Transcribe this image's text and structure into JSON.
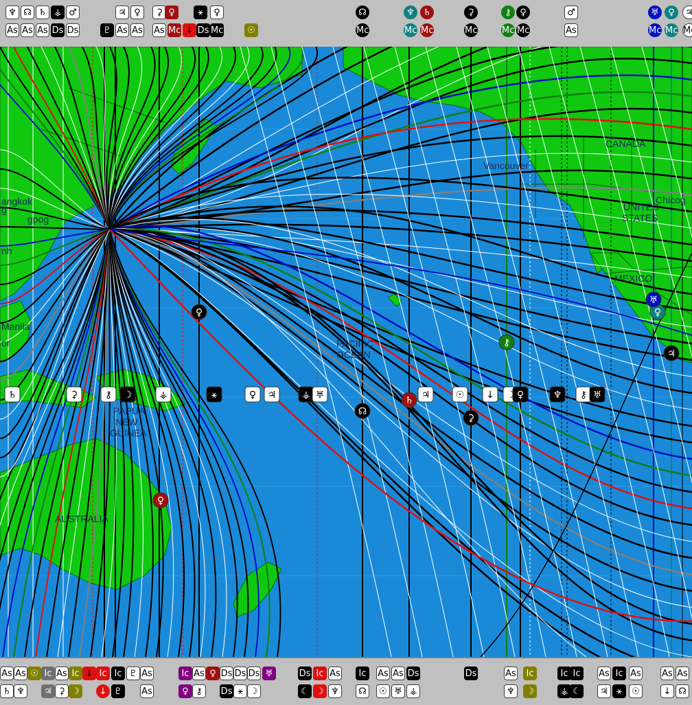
{
  "map": {
    "labels": {
      "canada": "CANADA",
      "vancouver": "Vancouver",
      "chicago": "Chicog",
      "united": "UNITED",
      "states": "STATES",
      "mexico": "MEXICO",
      "pacific": "PACIFIC",
      "ocean": "OCEAN",
      "papua": "PAPUA",
      "new": "NEW",
      "guinea": "GUINEA",
      "australia": "AUSTRALIA",
      "manila": "Manila",
      "frag_bangkok": "angkok",
      "frag_g": "g",
      "frag_dog": "gpog",
      "frag_nh": "nh",
      "frag_or": "or"
    }
  },
  "top_bar": {
    "row1": [
      {
        "g": "♆",
        "bg": "#ffffff",
        "fg": "#000000"
      },
      {
        "g": "☊",
        "bg": "#ffffff",
        "fg": "#000000"
      },
      {
        "g": "♄",
        "bg": "#ffffff",
        "fg": "#000000"
      },
      {
        "g": "⚶",
        "bg": "#000000",
        "fg": "#ffffff"
      },
      {
        "g": "♂",
        "bg": "#ffffff",
        "fg": "#000000"
      },
      {
        "g": "♃",
        "bg": "#ffffff",
        "fg": "#000000"
      },
      {
        "g": "♀",
        "bg": "#ffffff",
        "fg": "#000000"
      },
      {
        "g": "⚳",
        "bg": "#ffffff",
        "fg": "#000000"
      },
      {
        "g": "♀",
        "bg": "#a01010",
        "fg": "#ffffff"
      },
      {
        "g": "⚹",
        "bg": "#000000",
        "fg": "#ffffff"
      },
      {
        "g": "♀",
        "bg": "#ffffff",
        "fg": "#000000"
      },
      {
        "g": "☊",
        "bg": "#000000",
        "fg": "#ffffff",
        "round": true
      },
      {
        "g": "♆",
        "bg": "#108080",
        "fg": "#ffffff",
        "round": true
      },
      {
        "g": "♄",
        "bg": "#a01010",
        "fg": "#ffffff",
        "round": true
      },
      {
        "g": "⚳",
        "bg": "#000000",
        "fg": "#ffffff",
        "round": true
      },
      {
        "g": "⚷",
        "bg": "#108010",
        "fg": "#ffffff",
        "round": true
      },
      {
        "g": "♀",
        "bg": "#000000",
        "fg": "#ffffff",
        "round": true
      },
      {
        "g": "♂",
        "bg": "#ffffff",
        "fg": "#000000"
      },
      {
        "g": "♅",
        "bg": "#0010c0",
        "fg": "#ffffff",
        "round": true
      },
      {
        "g": "♀",
        "bg": "#108080",
        "fg": "#ffffff",
        "round": true
      },
      {
        "g": "♃",
        "bg": "#ffffff",
        "fg": "#000000",
        "round": true
      }
    ],
    "row2": [
      {
        "g": "As",
        "bg": "#ffffff",
        "fg": "#000000"
      },
      {
        "g": "As",
        "bg": "#ffffff",
        "fg": "#000000"
      },
      {
        "g": "As",
        "bg": "#ffffff",
        "fg": "#000000"
      },
      {
        "g": "Ds",
        "bg": "#000000",
        "fg": "#ffffff"
      },
      {
        "g": "Ds",
        "bg": "#ffffff",
        "fg": "#000000"
      },
      {
        "g": "♇",
        "bg": "#000000",
        "fg": "#ffffff"
      },
      {
        "g": "As",
        "bg": "#ffffff",
        "fg": "#000000"
      },
      {
        "g": "As",
        "bg": "#ffffff",
        "fg": "#000000"
      },
      {
        "g": "As",
        "bg": "#ffffff",
        "fg": "#000000"
      },
      {
        "g": "Mc",
        "bg": "#a01010",
        "fg": "#ffffff"
      },
      {
        "g": "↓",
        "bg": "#e01010",
        "fg": "#000000"
      },
      {
        "g": "Ds",
        "bg": "#000000",
        "fg": "#ffffff"
      },
      {
        "g": "Mc",
        "bg": "#000000",
        "fg": "#ffffff"
      },
      {
        "g": "☉",
        "bg": "#808000",
        "fg": "#ffffff"
      },
      {
        "g": "Mc",
        "bg": "#000000",
        "fg": "#ffffff",
        "round": true
      },
      {
        "g": "Mc",
        "bg": "#108080",
        "fg": "#ffffff",
        "round": true
      },
      {
        "g": "Mc",
        "bg": "#a01010",
        "fg": "#ffffff",
        "round": true
      },
      {
        "g": "Mc",
        "bg": "#000000",
        "fg": "#ffffff",
        "round": true
      },
      {
        "g": "Mc",
        "bg": "#108010",
        "fg": "#ffffff",
        "round": true
      },
      {
        "g": "Mc",
        "bg": "#000000",
        "fg": "#ffffff",
        "round": true
      },
      {
        "g": "As",
        "bg": "#ffffff",
        "fg": "#000000"
      },
      {
        "g": "Mc",
        "bg": "#0010c0",
        "fg": "#ffffff",
        "round": true
      },
      {
        "g": "Mc",
        "bg": "#108080",
        "fg": "#ffffff",
        "round": true
      },
      {
        "g": "Mc",
        "bg": "#ffffff",
        "fg": "#000000",
        "round": true
      }
    ]
  },
  "map_glyphs": [
    {
      "g": "♄",
      "bg": "#ffffff",
      "fg": "#000000"
    },
    {
      "g": "⚳",
      "bg": "#ffffff",
      "fg": "#000000"
    },
    {
      "g": "⚷",
      "bg": "#ffffff",
      "fg": "#000000"
    },
    {
      "g": "☽",
      "bg": "#000000",
      "fg": "#ffffff"
    },
    {
      "g": "⚶",
      "bg": "#ffffff",
      "fg": "#000000"
    },
    {
      "g": "⚹",
      "bg": "#000000",
      "fg": "#ffffff"
    },
    {
      "g": "♀",
      "bg": "#ffffff",
      "fg": "#000000"
    },
    {
      "g": "♃",
      "bg": "#ffffff",
      "fg": "#000000"
    },
    {
      "g": "⚶",
      "bg": "#000000",
      "fg": "#ffffff"
    },
    {
      "g": "♅",
      "bg": "#ffffff",
      "fg": "#000000"
    },
    {
      "g": "♄",
      "bg": "#a01010",
      "fg": "#ffffff",
      "round": true
    },
    {
      "g": "♃",
      "bg": "#ffffff",
      "fg": "#000000"
    },
    {
      "g": "☉",
      "bg": "#ffffff",
      "fg": "#000000"
    },
    {
      "g": "↓",
      "bg": "#ffffff",
      "fg": "#000000"
    },
    {
      "g": "☽",
      "bg": "#ffffff",
      "fg": "#000000"
    },
    {
      "g": "♀",
      "bg": "#000000",
      "fg": "#ffffff"
    },
    {
      "g": "♆",
      "bg": "#000000",
      "fg": "#ffffff"
    },
    {
      "g": "⚷",
      "bg": "#ffffff",
      "fg": "#000000"
    },
    {
      "g": "♅",
      "bg": "#000000",
      "fg": "#ffffff"
    },
    {
      "g": "♀",
      "bg": "#000000",
      "fg": "#ffffff",
      "round": true
    },
    {
      "g": "☊",
      "bg": "#000000",
      "fg": "#ffffff",
      "round": true
    },
    {
      "g": "⚳",
      "bg": "#000000",
      "fg": "#ffffff",
      "round": true
    },
    {
      "g": "♀",
      "bg": "#a01010",
      "fg": "#ffffff",
      "round": true
    },
    {
      "g": "⚷",
      "bg": "#108010",
      "fg": "#ffffff",
      "round": true
    },
    {
      "g": "♀",
      "bg": "#108080",
      "fg": "#ffffff",
      "round": true
    },
    {
      "g": "♅",
      "bg": "#0010c0",
      "fg": "#ffffff",
      "round": true
    },
    {
      "g": "♃",
      "bg": "#000000",
      "fg": "#ffffff",
      "round": true
    }
  ],
  "bottom_bar": {
    "row1": [
      {
        "g": "As",
        "bg": "#ffffff",
        "fg": "#000000"
      },
      {
        "g": "As",
        "bg": "#ffffff",
        "fg": "#000000"
      },
      {
        "g": "☉",
        "bg": "#808000",
        "fg": "#ffffff"
      },
      {
        "g": "Ic",
        "bg": "#707070",
        "fg": "#ffffff"
      },
      {
        "g": "As",
        "bg": "#ffffff",
        "fg": "#000000"
      },
      {
        "g": "Ic",
        "bg": "#808000",
        "fg": "#ffffff"
      },
      {
        "g": "↓",
        "bg": "#e01010",
        "fg": "#000000"
      },
      {
        "g": "Ic",
        "bg": "#e01010",
        "fg": "#ffffff"
      },
      {
        "g": "Ic",
        "bg": "#000000",
        "fg": "#ffffff"
      },
      {
        "g": "♇",
        "bg": "#ffffff",
        "fg": "#000000"
      },
      {
        "g": "As",
        "bg": "#ffffff",
        "fg": "#000000"
      },
      {
        "g": "Ic",
        "bg": "#800080",
        "fg": "#ffffff"
      },
      {
        "g": "As",
        "bg": "#ffffff",
        "fg": "#000000"
      },
      {
        "g": "♀",
        "bg": "#a01010",
        "fg": "#ffffff"
      },
      {
        "g": "Ds",
        "bg": "#ffffff",
        "fg": "#000000"
      },
      {
        "g": "Ds",
        "bg": "#ffffff",
        "fg": "#000000"
      },
      {
        "g": "Ds",
        "bg": "#ffffff",
        "fg": "#000000"
      },
      {
        "g": "♅",
        "bg": "#800080",
        "fg": "#ffffff"
      },
      {
        "g": "Ds",
        "bg": "#000000",
        "fg": "#ffffff"
      },
      {
        "g": "Ic",
        "bg": "#e01010",
        "fg": "#ffffff"
      },
      {
        "g": "As",
        "bg": "#ffffff",
        "fg": "#000000"
      },
      {
        "g": "Ic",
        "bg": "#000000",
        "fg": "#ffffff"
      },
      {
        "g": "As",
        "bg": "#ffffff",
        "fg": "#000000"
      },
      {
        "g": "As",
        "bg": "#ffffff",
        "fg": "#000000"
      },
      {
        "g": "Ds",
        "bg": "#000000",
        "fg": "#ffffff"
      },
      {
        "g": "Ds",
        "bg": "#000000",
        "fg": "#ffffff"
      },
      {
        "g": "As",
        "bg": "#ffffff",
        "fg": "#000000"
      },
      {
        "g": "Ic",
        "bg": "#808000",
        "fg": "#ffffff"
      },
      {
        "g": "Ic",
        "bg": "#000000",
        "fg": "#ffffff"
      },
      {
        "g": "Ic",
        "bg": "#000000",
        "fg": "#ffffff"
      },
      {
        "g": "As",
        "bg": "#ffffff",
        "fg": "#000000"
      },
      {
        "g": "Ic",
        "bg": "#000000",
        "fg": "#ffffff"
      },
      {
        "g": "As",
        "bg": "#ffffff",
        "fg": "#000000"
      },
      {
        "g": "As",
        "bg": "#ffffff",
        "fg": "#000000"
      },
      {
        "g": "As",
        "bg": "#ffffff",
        "fg": "#000000"
      }
    ],
    "row2": [
      {
        "g": "♄",
        "bg": "#ffffff",
        "fg": "#000000"
      },
      {
        "g": "♆",
        "bg": "#ffffff",
        "fg": "#000000"
      },
      {
        "g": "♃",
        "bg": "#707070",
        "fg": "#ffffff"
      },
      {
        "g": "⚳",
        "bg": "#ffffff",
        "fg": "#000000"
      },
      {
        "g": "☽",
        "bg": "#808000",
        "fg": "#ffffff"
      },
      {
        "g": "↓",
        "bg": "#e01010",
        "fg": "#ffffff",
        "round": true
      },
      {
        "g": "♇",
        "bg": "#000000",
        "fg": "#ffffff"
      },
      {
        "g": "As",
        "bg": "#ffffff",
        "fg": "#000000"
      },
      {
        "g": "♀",
        "bg": "#800080",
        "fg": "#ffffff"
      },
      {
        "g": "⚷",
        "bg": "#ffffff",
        "fg": "#000000"
      },
      {
        "g": "Ds",
        "bg": "#000000",
        "fg": "#ffffff"
      },
      {
        "g": "⚹",
        "bg": "#ffffff",
        "fg": "#000000"
      },
      {
        "g": "☽",
        "bg": "#ffffff",
        "fg": "#000000"
      },
      {
        "g": "☾",
        "bg": "#000000",
        "fg": "#ffffff"
      },
      {
        "g": "☽",
        "bg": "#e01010",
        "fg": "#ffffff"
      },
      {
        "g": "♆",
        "bg": "#ffffff",
        "fg": "#000000"
      },
      {
        "g": "☊",
        "bg": "#ffffff",
        "fg": "#000000"
      },
      {
        "g": "☉",
        "bg": "#ffffff",
        "fg": "#000000"
      },
      {
        "g": "♅",
        "bg": "#ffffff",
        "fg": "#000000"
      },
      {
        "g": "⚶",
        "bg": "#ffffff",
        "fg": "#000000"
      },
      {
        "g": "♆",
        "bg": "#ffffff",
        "fg": "#000000"
      },
      {
        "g": "☽",
        "bg": "#808000",
        "fg": "#ffffff"
      },
      {
        "g": "⚶",
        "bg": "#000000",
        "fg": "#ffffff"
      },
      {
        "g": "☾",
        "bg": "#000000",
        "fg": "#ffffff"
      },
      {
        "g": "♃",
        "bg": "#ffffff",
        "fg": "#000000"
      },
      {
        "g": "⚹",
        "bg": "#000000",
        "fg": "#ffffff"
      },
      {
        "g": "☉",
        "bg": "#ffffff",
        "fg": "#000000"
      },
      {
        "g": "↓",
        "bg": "#ffffff",
        "fg": "#000000"
      },
      {
        "g": "☊",
        "bg": "#ffffff",
        "fg": "#000000"
      }
    ]
  }
}
